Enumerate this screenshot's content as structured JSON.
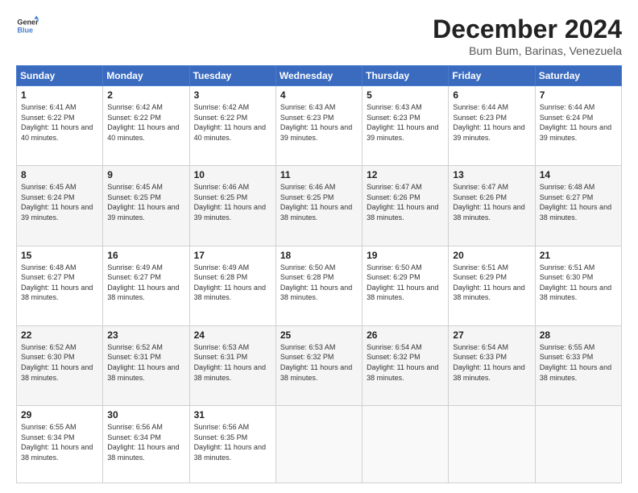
{
  "header": {
    "logo_line1": "General",
    "logo_line2": "Blue",
    "main_title": "December 2024",
    "subtitle": "Bum Bum, Barinas, Venezuela"
  },
  "days_of_week": [
    "Sunday",
    "Monday",
    "Tuesday",
    "Wednesday",
    "Thursday",
    "Friday",
    "Saturday"
  ],
  "weeks": [
    [
      {
        "day": "1",
        "sunrise": "Sunrise: 6:41 AM",
        "sunset": "Sunset: 6:22 PM",
        "daylight": "Daylight: 11 hours and 40 minutes."
      },
      {
        "day": "2",
        "sunrise": "Sunrise: 6:42 AM",
        "sunset": "Sunset: 6:22 PM",
        "daylight": "Daylight: 11 hours and 40 minutes."
      },
      {
        "day": "3",
        "sunrise": "Sunrise: 6:42 AM",
        "sunset": "Sunset: 6:22 PM",
        "daylight": "Daylight: 11 hours and 40 minutes."
      },
      {
        "day": "4",
        "sunrise": "Sunrise: 6:43 AM",
        "sunset": "Sunset: 6:23 PM",
        "daylight": "Daylight: 11 hours and 39 minutes."
      },
      {
        "day": "5",
        "sunrise": "Sunrise: 6:43 AM",
        "sunset": "Sunset: 6:23 PM",
        "daylight": "Daylight: 11 hours and 39 minutes."
      },
      {
        "day": "6",
        "sunrise": "Sunrise: 6:44 AM",
        "sunset": "Sunset: 6:23 PM",
        "daylight": "Daylight: 11 hours and 39 minutes."
      },
      {
        "day": "7",
        "sunrise": "Sunrise: 6:44 AM",
        "sunset": "Sunset: 6:24 PM",
        "daylight": "Daylight: 11 hours and 39 minutes."
      }
    ],
    [
      {
        "day": "8",
        "sunrise": "Sunrise: 6:45 AM",
        "sunset": "Sunset: 6:24 PM",
        "daylight": "Daylight: 11 hours and 39 minutes."
      },
      {
        "day": "9",
        "sunrise": "Sunrise: 6:45 AM",
        "sunset": "Sunset: 6:25 PM",
        "daylight": "Daylight: 11 hours and 39 minutes."
      },
      {
        "day": "10",
        "sunrise": "Sunrise: 6:46 AM",
        "sunset": "Sunset: 6:25 PM",
        "daylight": "Daylight: 11 hours and 39 minutes."
      },
      {
        "day": "11",
        "sunrise": "Sunrise: 6:46 AM",
        "sunset": "Sunset: 6:25 PM",
        "daylight": "Daylight: 11 hours and 38 minutes."
      },
      {
        "day": "12",
        "sunrise": "Sunrise: 6:47 AM",
        "sunset": "Sunset: 6:26 PM",
        "daylight": "Daylight: 11 hours and 38 minutes."
      },
      {
        "day": "13",
        "sunrise": "Sunrise: 6:47 AM",
        "sunset": "Sunset: 6:26 PM",
        "daylight": "Daylight: 11 hours and 38 minutes."
      },
      {
        "day": "14",
        "sunrise": "Sunrise: 6:48 AM",
        "sunset": "Sunset: 6:27 PM",
        "daylight": "Daylight: 11 hours and 38 minutes."
      }
    ],
    [
      {
        "day": "15",
        "sunrise": "Sunrise: 6:48 AM",
        "sunset": "Sunset: 6:27 PM",
        "daylight": "Daylight: 11 hours and 38 minutes."
      },
      {
        "day": "16",
        "sunrise": "Sunrise: 6:49 AM",
        "sunset": "Sunset: 6:27 PM",
        "daylight": "Daylight: 11 hours and 38 minutes."
      },
      {
        "day": "17",
        "sunrise": "Sunrise: 6:49 AM",
        "sunset": "Sunset: 6:28 PM",
        "daylight": "Daylight: 11 hours and 38 minutes."
      },
      {
        "day": "18",
        "sunrise": "Sunrise: 6:50 AM",
        "sunset": "Sunset: 6:28 PM",
        "daylight": "Daylight: 11 hours and 38 minutes."
      },
      {
        "day": "19",
        "sunrise": "Sunrise: 6:50 AM",
        "sunset": "Sunset: 6:29 PM",
        "daylight": "Daylight: 11 hours and 38 minutes."
      },
      {
        "day": "20",
        "sunrise": "Sunrise: 6:51 AM",
        "sunset": "Sunset: 6:29 PM",
        "daylight": "Daylight: 11 hours and 38 minutes."
      },
      {
        "day": "21",
        "sunrise": "Sunrise: 6:51 AM",
        "sunset": "Sunset: 6:30 PM",
        "daylight": "Daylight: 11 hours and 38 minutes."
      }
    ],
    [
      {
        "day": "22",
        "sunrise": "Sunrise: 6:52 AM",
        "sunset": "Sunset: 6:30 PM",
        "daylight": "Daylight: 11 hours and 38 minutes."
      },
      {
        "day": "23",
        "sunrise": "Sunrise: 6:52 AM",
        "sunset": "Sunset: 6:31 PM",
        "daylight": "Daylight: 11 hours and 38 minutes."
      },
      {
        "day": "24",
        "sunrise": "Sunrise: 6:53 AM",
        "sunset": "Sunset: 6:31 PM",
        "daylight": "Daylight: 11 hours and 38 minutes."
      },
      {
        "day": "25",
        "sunrise": "Sunrise: 6:53 AM",
        "sunset": "Sunset: 6:32 PM",
        "daylight": "Daylight: 11 hours and 38 minutes."
      },
      {
        "day": "26",
        "sunrise": "Sunrise: 6:54 AM",
        "sunset": "Sunset: 6:32 PM",
        "daylight": "Daylight: 11 hours and 38 minutes."
      },
      {
        "day": "27",
        "sunrise": "Sunrise: 6:54 AM",
        "sunset": "Sunset: 6:33 PM",
        "daylight": "Daylight: 11 hours and 38 minutes."
      },
      {
        "day": "28",
        "sunrise": "Sunrise: 6:55 AM",
        "sunset": "Sunset: 6:33 PM",
        "daylight": "Daylight: 11 hours and 38 minutes."
      }
    ],
    [
      {
        "day": "29",
        "sunrise": "Sunrise: 6:55 AM",
        "sunset": "Sunset: 6:34 PM",
        "daylight": "Daylight: 11 hours and 38 minutes."
      },
      {
        "day": "30",
        "sunrise": "Sunrise: 6:56 AM",
        "sunset": "Sunset: 6:34 PM",
        "daylight": "Daylight: 11 hours and 38 minutes."
      },
      {
        "day": "31",
        "sunrise": "Sunrise: 6:56 AM",
        "sunset": "Sunset: 6:35 PM",
        "daylight": "Daylight: 11 hours and 38 minutes."
      },
      null,
      null,
      null,
      null
    ]
  ]
}
